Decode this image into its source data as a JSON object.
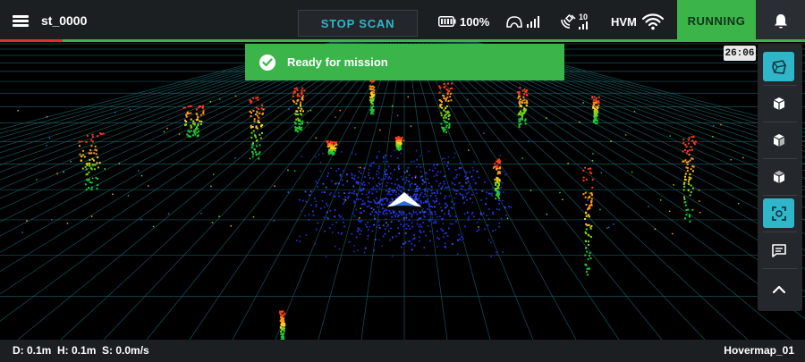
{
  "header": {
    "device_name": "st_0000",
    "stop_scan_label": "STOP SCAN",
    "battery_text": "100%",
    "hvm_label": "HVM",
    "gps_satellites": "10",
    "status_label": "RUNNING"
  },
  "toast": {
    "message": "Ready for mission"
  },
  "timer": "26:06",
  "footer": {
    "stats": "D: 0.1m  H: 0.1m  S: 0.0m/s",
    "unit_name": "Hovermap_01"
  },
  "colors": {
    "accent_green": "#3bb54a",
    "accent_cyan": "#2fb6c9",
    "alert_red": "#e02f2f"
  },
  "view_buttons": [
    {
      "name": "perspective-view",
      "active": true
    },
    {
      "name": "front-view",
      "active": false
    },
    {
      "name": "side-view",
      "active": false
    },
    {
      "name": "top-view",
      "active": false
    },
    {
      "name": "recenter-view",
      "active": true
    },
    {
      "name": "message",
      "active": false
    },
    {
      "name": "collapse",
      "active": false
    }
  ]
}
